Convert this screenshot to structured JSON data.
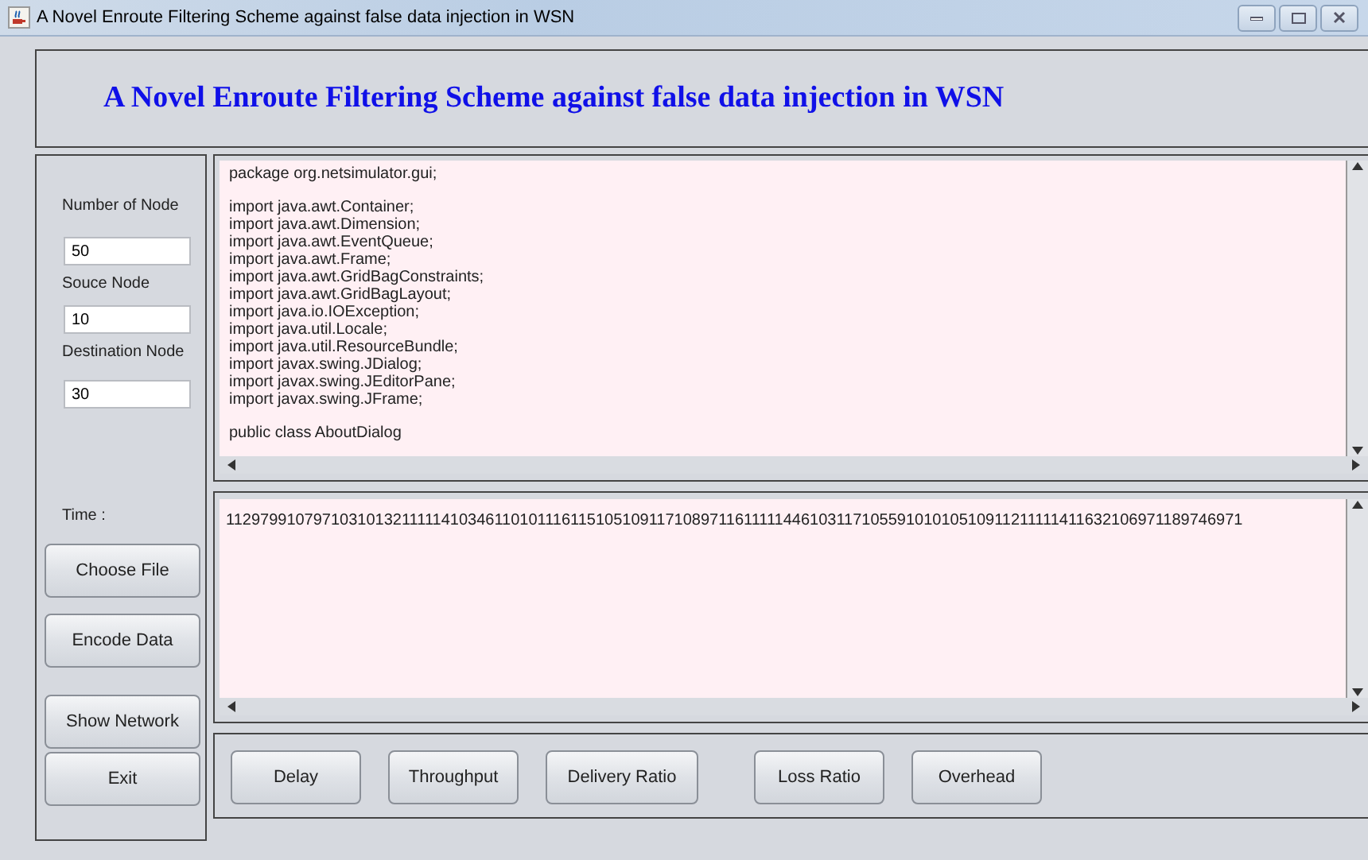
{
  "window": {
    "title": "A Novel Enroute Filtering Scheme against false data injection in WSN"
  },
  "header": {
    "title": "A Novel Enroute Filtering Scheme against false data injection in WSN"
  },
  "sidebar": {
    "fields": [
      {
        "label": "Number of Node",
        "value": "50"
      },
      {
        "label": "Souce Node",
        "value": "10"
      },
      {
        "label": "Destination Node",
        "value": "30"
      }
    ],
    "time_label": "Time :",
    "buttons": [
      "Choose File",
      "Encode Data",
      "Show Network",
      "Exit"
    ]
  },
  "source_view": {
    "blocks": [
      [
        "package org.netsimulator.gui;"
      ],
      [
        "import java.awt.Container;",
        "import java.awt.Dimension;",
        "import java.awt.EventQueue;",
        "import java.awt.Frame;",
        "import java.awt.GridBagConstraints;",
        "import java.awt.GridBagLayout;",
        "import java.io.IOException;",
        "import java.util.Locale;",
        "import java.util.ResourceBundle;",
        "import javax.swing.JDialog;",
        "import javax.swing.JEditorPane;",
        "import javax.swing.JFrame;"
      ],
      [
        "public class AboutDialog"
      ]
    ]
  },
  "encoded_view": {
    "text": "1129799107971031013211111410346110101116115105109117108971161111144610311710559101010510911211111411632106971189746971"
  },
  "metric_buttons": [
    "Delay",
    "Throughput",
    "Delivery Ratio",
    "Loss Ratio",
    "Overhead"
  ]
}
